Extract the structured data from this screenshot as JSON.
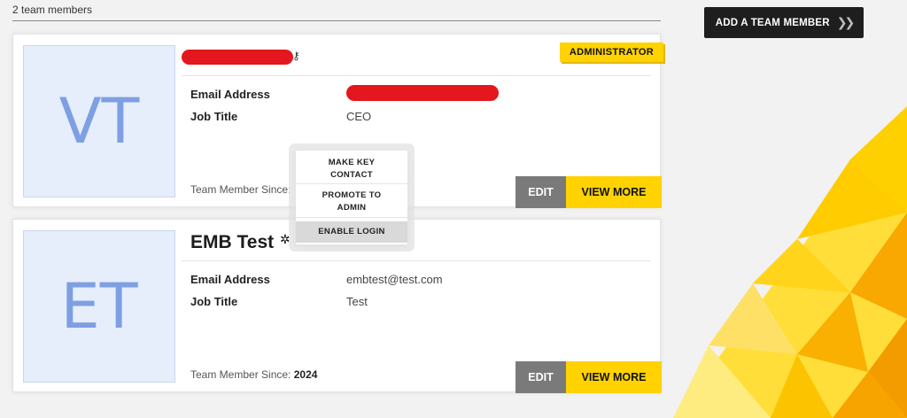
{
  "team": {
    "count_label": "2 team members"
  },
  "actions": {
    "add_member": "ADD A TEAM MEMBER",
    "add_member_chevron": "»"
  },
  "labels": {
    "email": "Email Address",
    "job_title": "Job Title",
    "since_prefix": "Team Member Since:",
    "edit": "EDIT",
    "view_more": "VIEW MORE"
  },
  "members": [
    {
      "initials": "VT",
      "role_badge": "ADMINISTRATOR",
      "job_title": "CEO",
      "name_redacted": true,
      "email_redacted": true,
      "icon": "key-icon"
    },
    {
      "initials": "ET",
      "name": "EMB Test",
      "email": "embtest@test.com",
      "job_title": "Test",
      "since_year": "2024",
      "icon": "gear-icon"
    }
  ],
  "context_menu": {
    "items": [
      {
        "line1": "MAKE KEY",
        "line2": "CONTACT"
      },
      {
        "line1": "PROMOTE TO",
        "line2": "ADMIN"
      },
      {
        "line1": "ENABLE LOGIN"
      }
    ],
    "highlighted_index": 2
  },
  "colors": {
    "accent_yellow": "#ffd200",
    "button_dark": "#1e1e1e",
    "button_gray": "#7a7a7a",
    "redaction": "#e3171d",
    "avatar_bg": "#e6eefb",
    "avatar_text": "#7f9fe3"
  }
}
